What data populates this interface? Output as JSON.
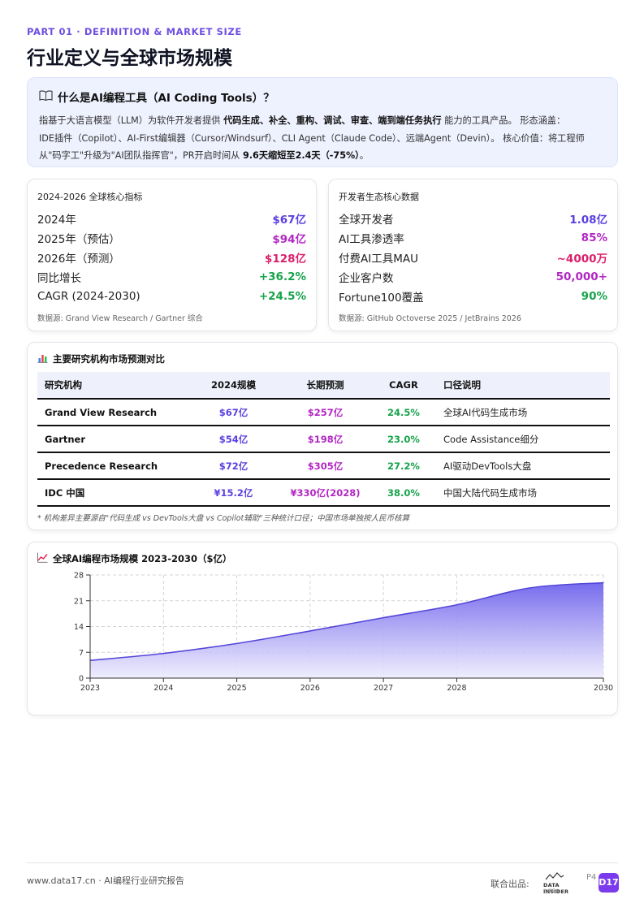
{
  "header": {
    "part_label": "PART 01 · DEFINITION & MARKET SIZE",
    "title": "行业定义与全球市场规模"
  },
  "definition": {
    "title": "什么是AI编程工具（AI Coding Tools）？",
    "line1_a": "指基于大语言模型（LLM）为软件开发者提供 ",
    "line1_b": "代码生成、补全、重构、调试、审查、端到端任务执行",
    "line1_c": " 能力的工具产品。 形态涵盖：",
    "line2": "IDE插件（Copilot）、AI-First编辑器（Cursor/Windsurf）、CLI Agent（Claude Code）、远端Agent（Devin）。 核心价值：将工程师",
    "line3_a": "从\"码字工\"升级为\"AI团队指挥官\"，PR开启时间从 ",
    "line3_b": "9.6天缩短至2.4天（-75%）",
    "line3_c": "。"
  },
  "core_metrics": {
    "title": "2024-2026 全球核心指标",
    "rows": [
      {
        "label": "2024年",
        "value": "$67亿",
        "color": "#5b3fe0"
      },
      {
        "label": "2025年（预估）",
        "value": "$94亿",
        "color": "#b326c4"
      },
      {
        "label": "2026年（预测）",
        "value": "$128亿",
        "color": "#db1f6a"
      },
      {
        "label": "同比增长",
        "value": "+36.2%",
        "color": "#16a34a"
      },
      {
        "label": "CAGR (2024-2030)",
        "value": "+24.5%",
        "color": "#16a34a"
      }
    ],
    "source": "数据源: Grand View Research / Gartner 综合"
  },
  "ecosystem": {
    "title": "开发者生态核心数据",
    "rows": [
      {
        "label": "全球开发者",
        "value": "1.08亿",
        "color": "#5b3fe0"
      },
      {
        "label": "AI工具渗透率",
        "value": "85%",
        "color": "#b326c4"
      },
      {
        "label": "付费AI工具MAU",
        "value": "~4000万",
        "color": "#db1f6a"
      },
      {
        "label": "企业客户数",
        "value": "50,000+",
        "color": "#b326c4"
      },
      {
        "label": "Fortune100覆盖",
        "value": "90%",
        "color": "#16a34a"
      }
    ],
    "source": "数据源: GitHub Octoverse 2025 / JetBrains 2026"
  },
  "forecast_table": {
    "title": "主要研究机构市场预测对比",
    "headers": [
      "研究机构",
      "2024规模",
      "长期预测",
      "CAGR",
      "口径说明"
    ],
    "rows": [
      [
        "Grand View Research",
        "$67亿",
        "$257亿",
        "24.5%",
        "全球AI代码生成市场"
      ],
      [
        "Gartner",
        "$54亿",
        "$198亿",
        "23.0%",
        "Code Assistance细分"
      ],
      [
        "Precedence Research",
        "$72亿",
        "$305亿",
        "27.2%",
        "AI驱动DevTools大盘"
      ],
      [
        "IDC 中国",
        "¥15.2亿",
        "¥330亿(2028)",
        "38.0%",
        "中国大陆代码生成市场"
      ]
    ],
    "note": "* 机构差异主要源自\"代码生成 vs DevTools大盘 vs Copilot辅助\"三种统计口径；中国市场单独按人民币核算"
  },
  "chart_title": "全球AI编程市场规模 2023-2030（$亿）",
  "chart_data": {
    "type": "area",
    "title": "全球AI编程市场规模 2023-2030（$亿）",
    "x": [
      2023,
      2024,
      2025,
      2026,
      2027,
      2028,
      2029,
      2030
    ],
    "x_ticks": [
      "2023",
      "2024",
      "2025",
      "2026",
      "2027",
      "2028",
      "2030"
    ],
    "series": [
      {
        "values": [
          4.8,
          6.7,
          9.4,
          12.8,
          16.4,
          19.9,
          24.5,
          25.9
        ]
      }
    ],
    "ylim": [
      0,
      28
    ],
    "y_ticks": [
      0,
      7,
      14,
      21,
      28
    ],
    "grid": true,
    "colors": {
      "fill_top": "#6f63ec",
      "fill_bottom": "#eceafd",
      "line": "#5446d9"
    }
  },
  "footer": {
    "site": "www.data17.cn · AI编程行业研究报告",
    "joint": "联合出品:",
    "logo_text": "DATA INSIDER",
    "logo_sub": "数据洞察",
    "page": "P4",
    "badge": "D17"
  }
}
